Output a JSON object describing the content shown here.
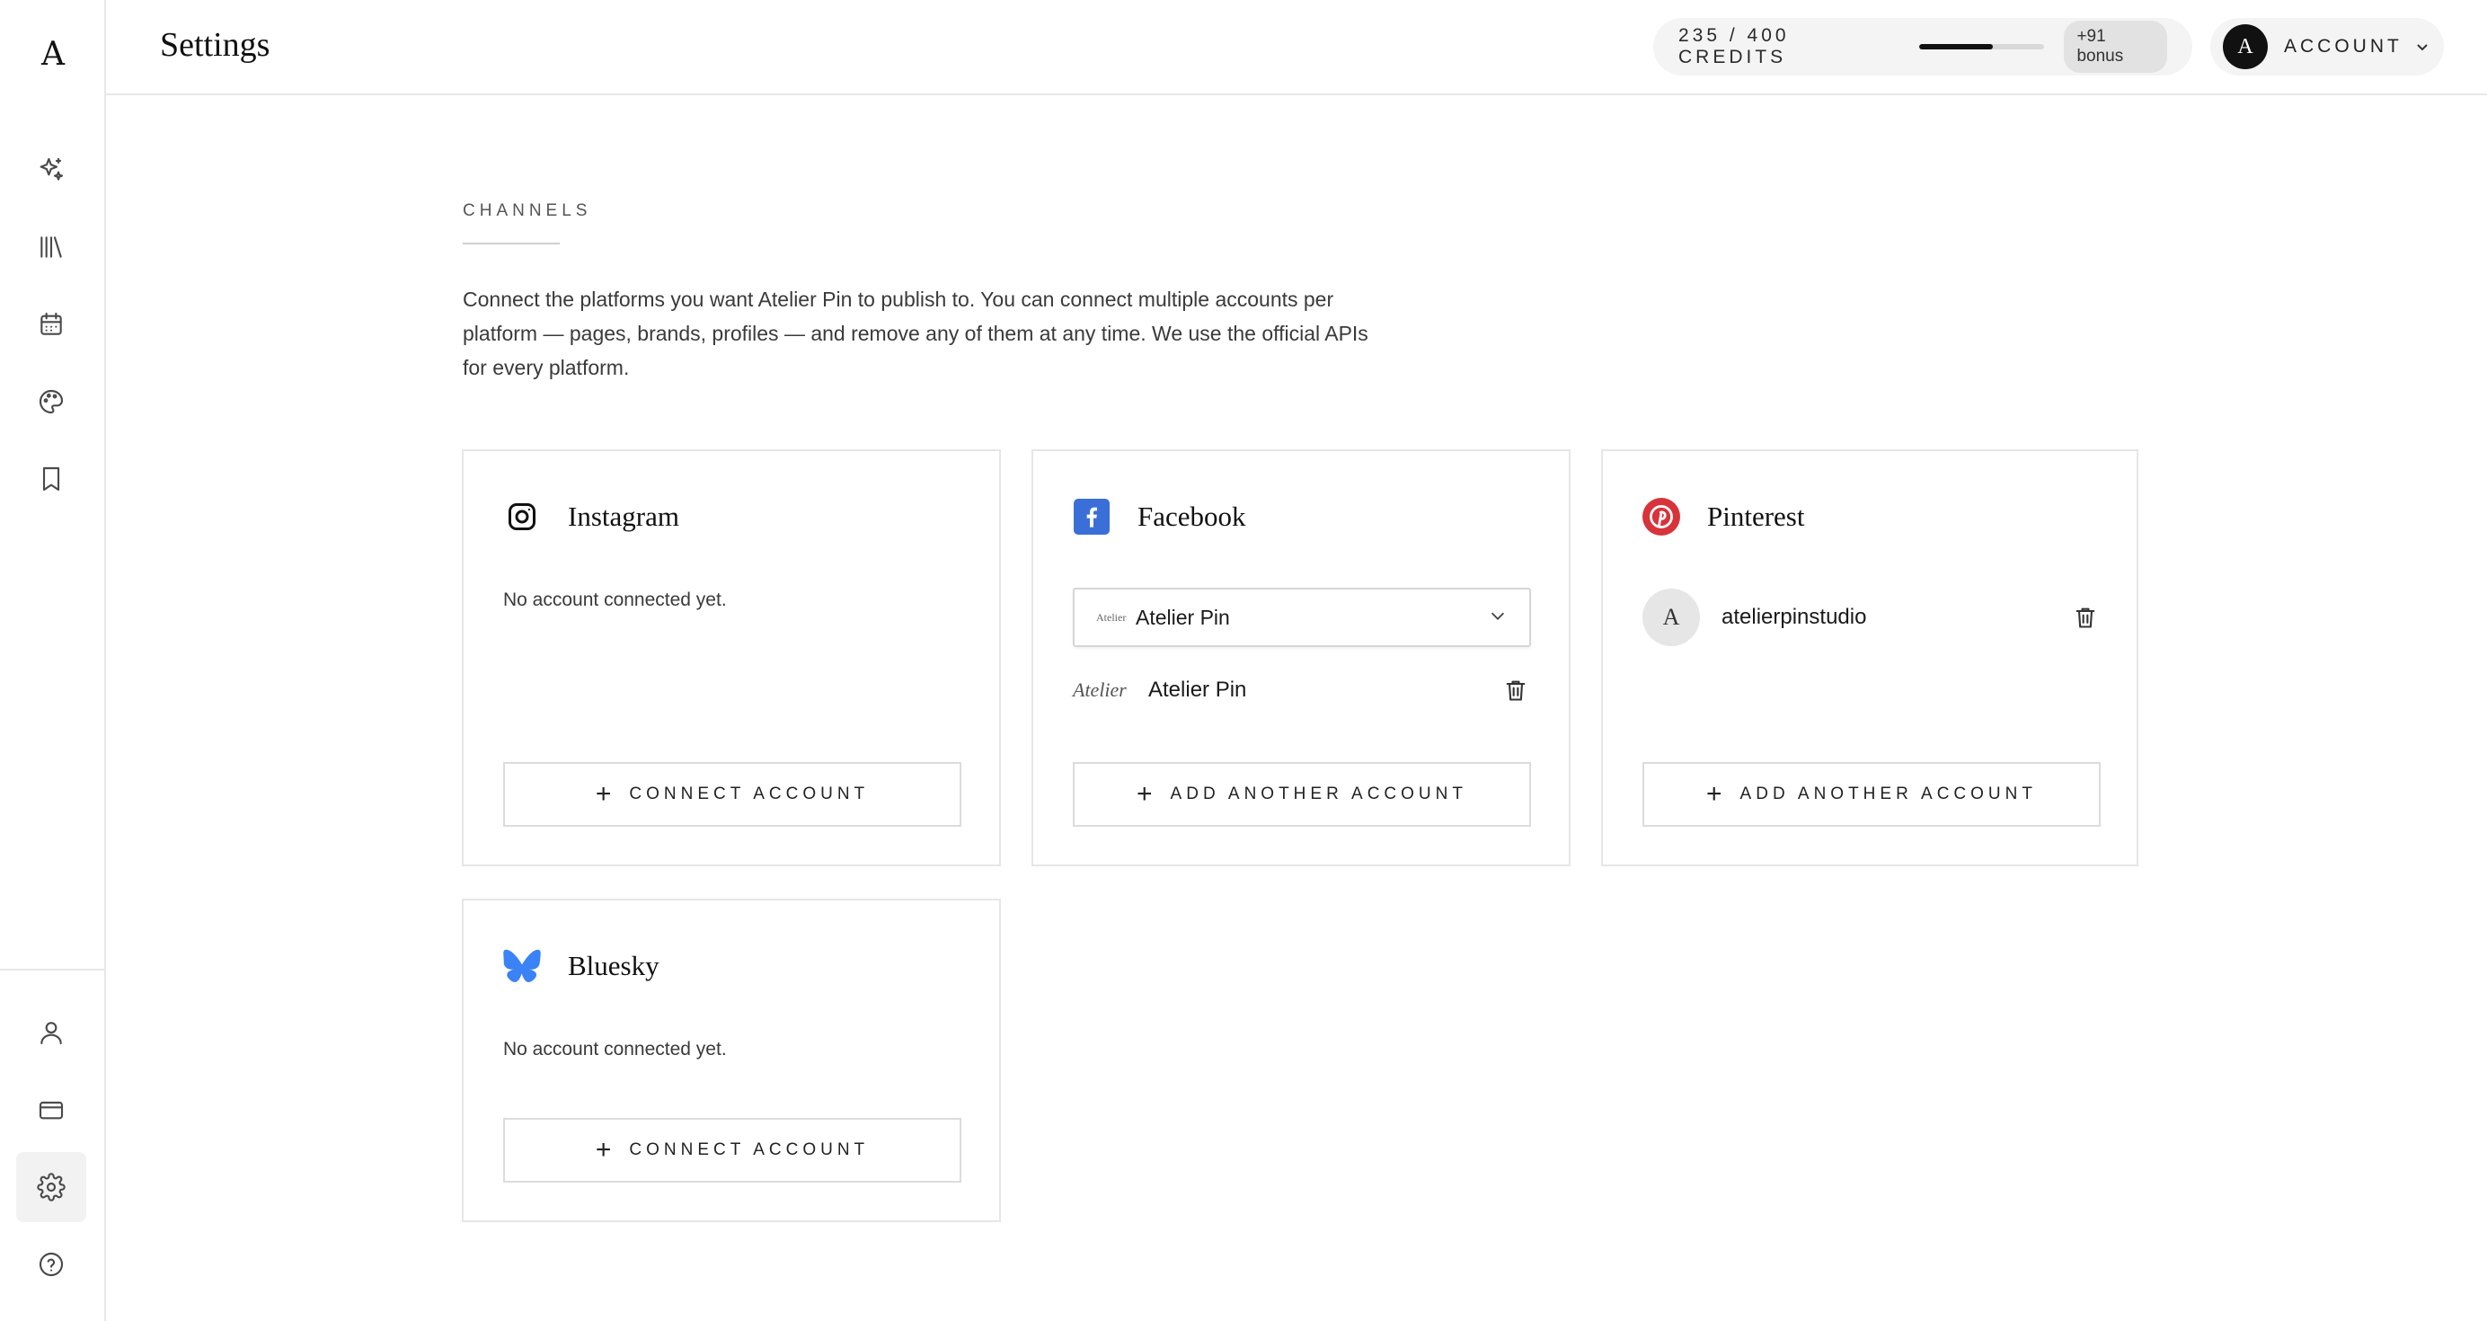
{
  "app": {
    "logo_letter": "A"
  },
  "header": {
    "title": "Settings",
    "credits": {
      "used": 235,
      "total": 400,
      "text": "235 / 400 CREDITS",
      "bonus": "+91 bonus",
      "fraction": 0.5875
    },
    "account": {
      "avatar_letter": "A",
      "label": "ACCOUNT"
    }
  },
  "sidebar": {
    "items": [
      {
        "name": "sparkles-icon"
      },
      {
        "name": "library-icon"
      },
      {
        "name": "calendar-icon"
      },
      {
        "name": "palette-icon"
      },
      {
        "name": "bookmark-icon"
      }
    ],
    "bottom_items": [
      {
        "name": "user-icon"
      },
      {
        "name": "card-icon"
      },
      {
        "name": "gear-icon",
        "active": true
      },
      {
        "name": "help-icon"
      }
    ]
  },
  "channels": {
    "label": "CHANNELS",
    "intro": "Connect the platforms you want Atelier Pin to publish to. You can connect multiple accounts per platform — pages, brands, profiles — and remove any of them at any time. We use the official APIs for every platform.",
    "cards": {
      "instagram": {
        "title": "Instagram",
        "empty": "No account connected yet.",
        "button": "CONNECT ACCOUNT"
      },
      "facebook": {
        "title": "Facebook",
        "selected": "Atelier Pin",
        "select_logo": "Atelier",
        "accounts": [
          {
            "logo": "Atelier",
            "name": "Atelier Pin"
          }
        ],
        "button": "ADD ANOTHER ACCOUNT"
      },
      "pinterest": {
        "title": "Pinterest",
        "accounts": [
          {
            "avatar_letter": "A",
            "name": "atelierpinstudio"
          }
        ],
        "button": "ADD ANOTHER ACCOUNT"
      },
      "bluesky": {
        "title": "Bluesky",
        "empty": "No account connected yet.",
        "button": "CONNECT ACCOUNT"
      }
    }
  },
  "colors": {
    "facebook": "#3b6fd8",
    "pinterest": "#d8323a",
    "bluesky": "#3b82f6",
    "accent": "#111111"
  }
}
